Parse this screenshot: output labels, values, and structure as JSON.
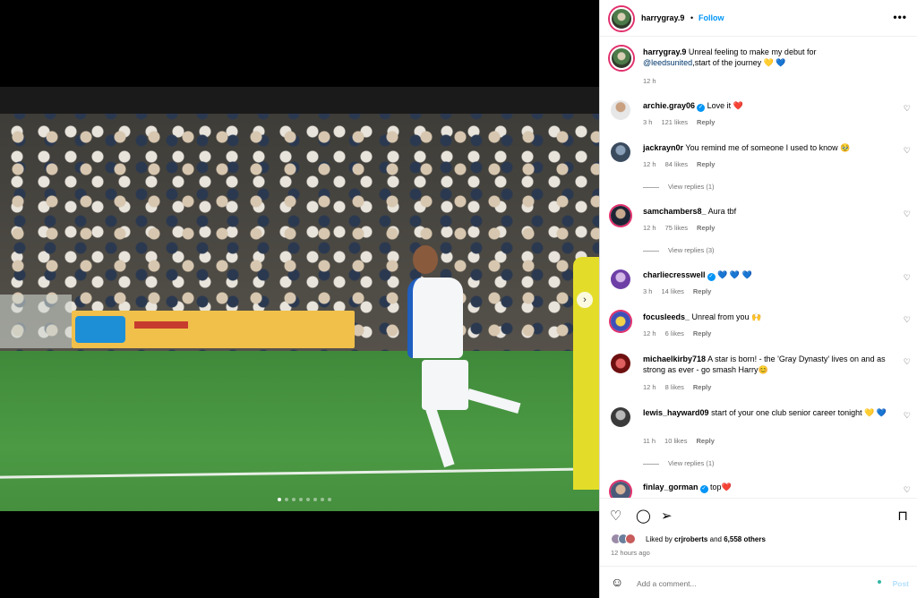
{
  "post": {
    "username": "harrygray.9",
    "separator": "•",
    "follow_label": "Follow",
    "more_icon": "•••",
    "caption_prefix": "Unreal feeling to make my debut for",
    "caption_mention": "@leedsunited",
    "caption_suffix": ",start of the journey 💛 💙",
    "caption_time": "12 h",
    "carousel_slides": 8,
    "active_slide": 0
  },
  "comments": [
    {
      "user": "archie.gray06",
      "verified": true,
      "text": "Love it ❤️",
      "time": "3 h",
      "likes": "121 likes",
      "reply": "Reply",
      "view_replies": ""
    },
    {
      "user": "jackrayn0r",
      "verified": false,
      "text": "You remind me of someone I used to know 🥹",
      "time": "12 h",
      "likes": "84 likes",
      "reply": "Reply",
      "view_replies": "View replies (1)"
    },
    {
      "user": "samchambers8_",
      "verified": false,
      "text": "Aura tbf",
      "time": "12 h",
      "likes": "75 likes",
      "reply": "Reply",
      "view_replies": "View replies (3)"
    },
    {
      "user": "charliecresswell",
      "verified": true,
      "text": "💙 💙 💙",
      "time": "3 h",
      "likes": "14 likes",
      "reply": "Reply",
      "view_replies": ""
    },
    {
      "user": "focusleeds_",
      "verified": false,
      "text": "Unreal from you 🙌",
      "time": "12 h",
      "likes": "6 likes",
      "reply": "Reply",
      "view_replies": ""
    },
    {
      "user": "michaelkirby718",
      "verified": false,
      "text": "A star is born! - the 'Gray Dynasty' lives on and as strong as ever - go smash Harry😊",
      "time": "12 h",
      "likes": "8 likes",
      "reply": "Reply",
      "view_replies": ""
    },
    {
      "user": "lewis_hayward09",
      "verified": false,
      "text": "start of your one club senior career tonight 💛 💙",
      "time": "11 h",
      "likes": "10 likes",
      "reply": "Reply",
      "view_replies": "View replies (1)"
    },
    {
      "user": "finlay_gorman",
      "verified": true,
      "text": "top❤️",
      "time": "",
      "likes": "",
      "reply": "",
      "view_replies": ""
    }
  ],
  "actions": {
    "like_icon": "heart-icon",
    "comment_icon": "comment-icon",
    "share_icon": "share-icon",
    "save_icon": "bookmark-icon",
    "liked_by_prefix": "Liked by",
    "liked_by_user": "crjroberts",
    "liked_by_and": "and",
    "liked_by_others": "6,558 others",
    "timestamp": "12 hours ago"
  },
  "add_comment": {
    "placeholder": "Add a comment...",
    "post_label": "Post"
  },
  "colors": {
    "accent": "#0095f6",
    "post_disabled": "#b2dffc",
    "muted": "#737373"
  }
}
